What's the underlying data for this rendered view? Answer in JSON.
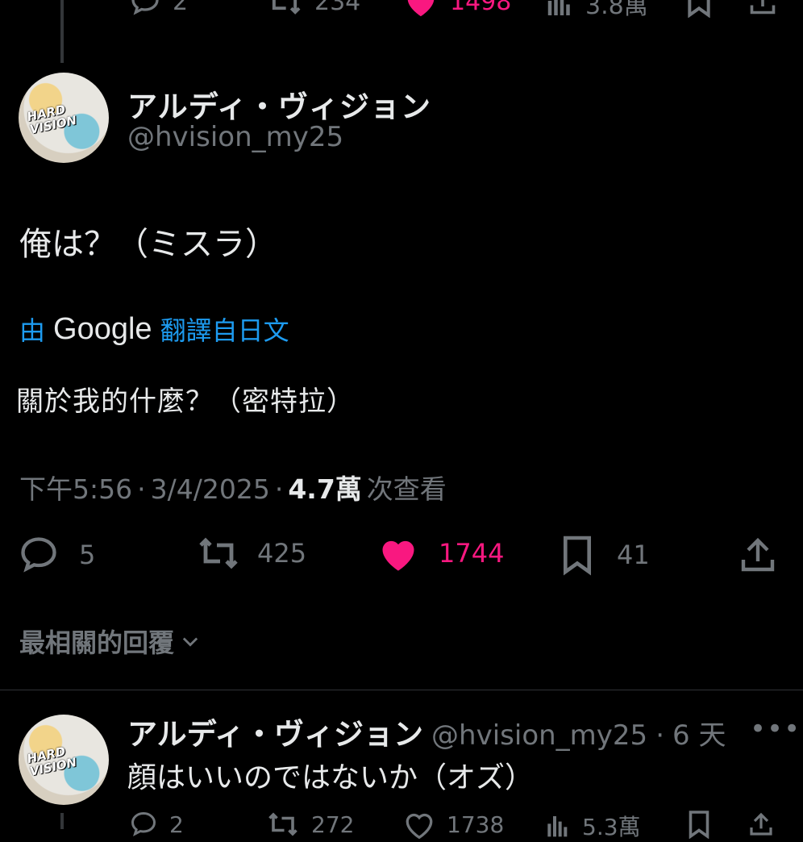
{
  "top_tweet_actions": {
    "replies": "2",
    "retweets": "234",
    "likes": "1498",
    "views": "3.8萬"
  },
  "tweet": {
    "display_name": "アルディ・ヴィジョン",
    "handle": "@hvision_my25",
    "text": "俺は？（ミスラ）",
    "translate_prefix": "由",
    "translate_brand": "Google",
    "translate_suffix": "翻譯自日文",
    "translated_text": "關於我的什麼？（密特拉）",
    "time": "下午5:56",
    "date": "3/4/2025",
    "views_count": "4.7萬",
    "views_label": "次查看",
    "replies": "5",
    "retweets": "425",
    "likes": "1744",
    "bookmarks": "41",
    "avatar_logo_line1": "HARD",
    "avatar_logo_line2": "VISION"
  },
  "sort_label": "最相關的回覆",
  "reply": {
    "display_name": "アルディ・ヴィジョン",
    "handle": "@hvision_my25",
    "age": "6 天",
    "text": "顔はいいのではないか（オズ）",
    "replies": "2",
    "retweets": "272",
    "likes": "1738",
    "views": "5.3萬"
  },
  "colors": {
    "background": "#000000",
    "text": "#e7e9ea",
    "muted": "#71767b",
    "like": "#f91880",
    "link": "#1d9bf0"
  }
}
